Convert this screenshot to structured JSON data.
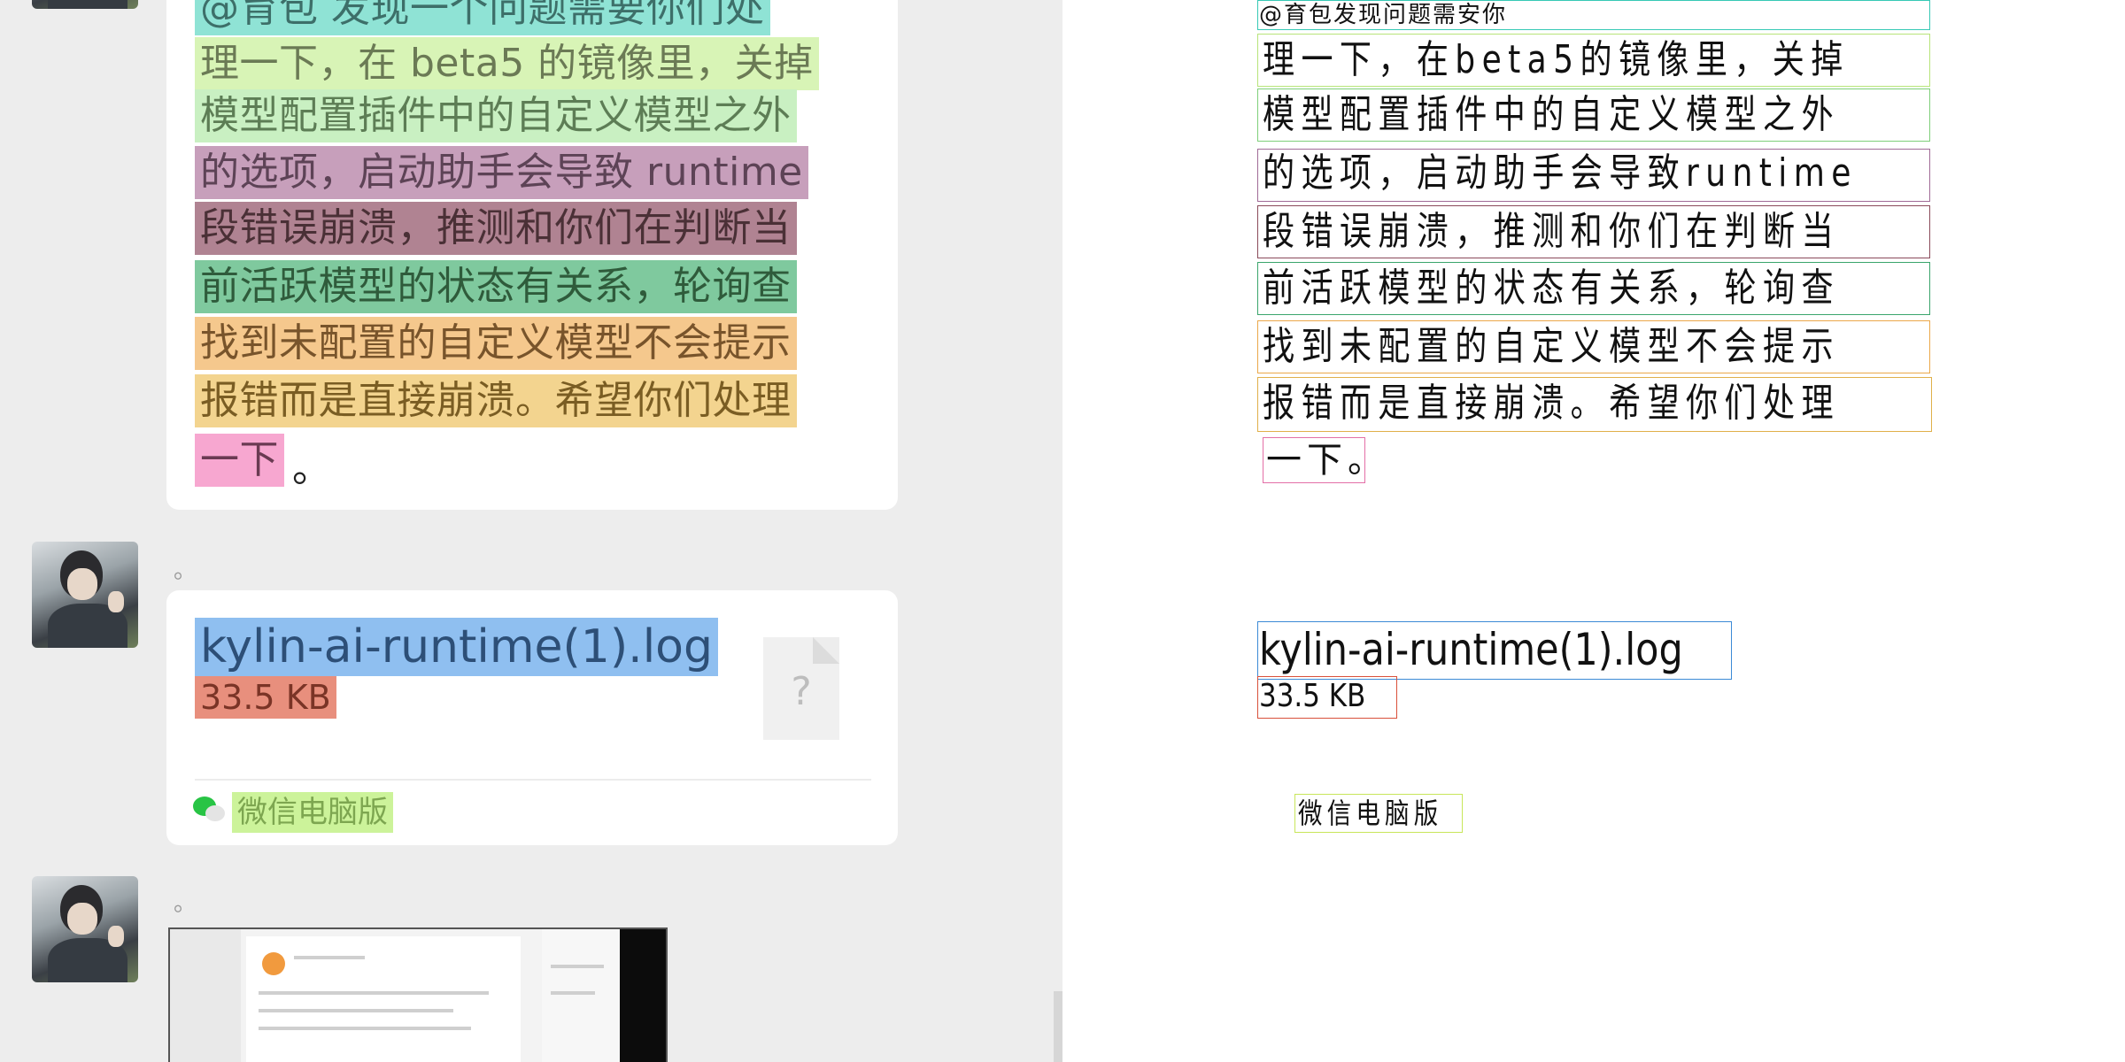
{
  "message": {
    "lines": [
      "@育包 发现一个问题需要你们处",
      "理一下，在 beta5 的镜像里，关掉",
      "模型配置插件中的自定义模型之外",
      "的选项，启动助手会导致 runtime",
      "段错误崩溃，推测和你们在判断当",
      "前活跃模型的状态有关系，轮询查",
      "找到未配置的自定义模型不会提示",
      "报错而是直接崩溃。希望你们处理",
      "一下"
    ],
    "trailing": "。"
  },
  "sender_dot_1": "。",
  "sender_dot_2": "。",
  "file": {
    "name": "kylin-ai-runtime(1).log",
    "size": "33.5 KB",
    "icon": "unknown-file-icon",
    "icon_glyph": "?",
    "source_label": "微信电脑版"
  },
  "ocr": {
    "lines": [
      "@育包发现问题需安你",
      "理一下，在beta5的镜像里，关掉",
      "模型配置插件中的自定义模型之外",
      "的选项，启动助手会导致runtime",
      "段错误崩溃，推测和你们在判断当",
      "前活跃模型的状态有关系，轮询查",
      "找到未配置的自定义模型不会提示",
      "报错而是直接崩溃。希望你们处理",
      "一下。"
    ],
    "file_name": "kylin-ai-runtime(1).log",
    "file_size": "33.5 KB",
    "source_label": "微信电脑版"
  },
  "colors": {
    "box_cyan": "#36c9b5",
    "box_lime": "#b7e47a",
    "box_green": "#7fcf7a",
    "box_purple": "#a06a96",
    "box_maroon": "#8a4a5a",
    "box_teal": "#3aa56c",
    "box_orange": "#eba84a",
    "box_gold": "#e0b04a",
    "box_pink": "#e36fa7",
    "box_blue": "#3c8ad6",
    "box_red": "#d9503a",
    "box_yellow": "#c8e65a"
  }
}
